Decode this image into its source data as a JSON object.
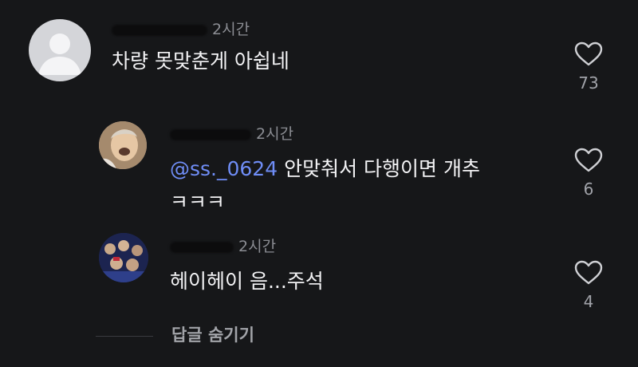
{
  "comments": [
    {
      "time": "2시간",
      "text": "차량 못맞춘게 아쉽네",
      "likes": "73"
    },
    {
      "time": "2시간",
      "mention": "@ss._0624",
      "text": " 안맞춰서 다행이면 개추",
      "text_line2": "ㅋㅋㅋ",
      "likes": "6"
    },
    {
      "time": "2시간",
      "text": "헤이헤이 음...주석",
      "likes": "4"
    }
  ],
  "hide_replies_label": "답글 숨기기",
  "icons": [
    "person-silhouette-icon",
    "heart-outline-icon"
  ],
  "colors": {
    "background": "#161719",
    "mention": "#6f8df6",
    "secondary_text": "#8b8d93"
  }
}
